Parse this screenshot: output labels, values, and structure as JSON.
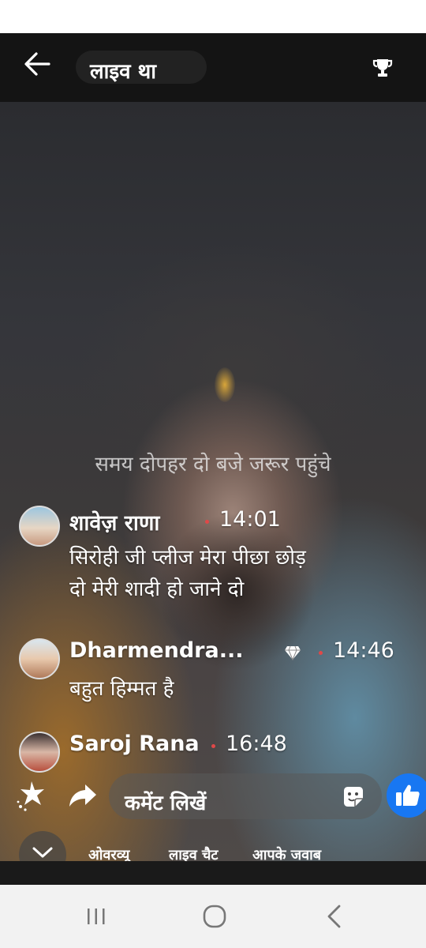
{
  "header": {
    "title": "लाइव था"
  },
  "caption": "समय दोपहर दो बजे जरूर पहुंचे",
  "comments": [
    {
      "name": "शावेज़ राणा",
      "time": "14:01",
      "lines": [
        "सिरोही जी प्लीज मेरा पीछा छोड़",
        "दो मेरी शादी हो जाने दो"
      ]
    },
    {
      "name": "Dharmendra...",
      "time": "14:46",
      "lines": [
        "बहुत हिम्मत है"
      ],
      "badge": "diamond-icon"
    },
    {
      "name": "Saroj Rana",
      "time": "16:48",
      "lines": []
    }
  ],
  "actionbar": {
    "comment_placeholder": "कमेंट लिखें"
  },
  "tabs": [
    "ओवरव्यू",
    "लाइव चैट",
    "आपके जवाब"
  ],
  "colors": {
    "like_blue": "#1877f2",
    "header_bg": "#141414",
    "live_dot": "#e04848"
  }
}
